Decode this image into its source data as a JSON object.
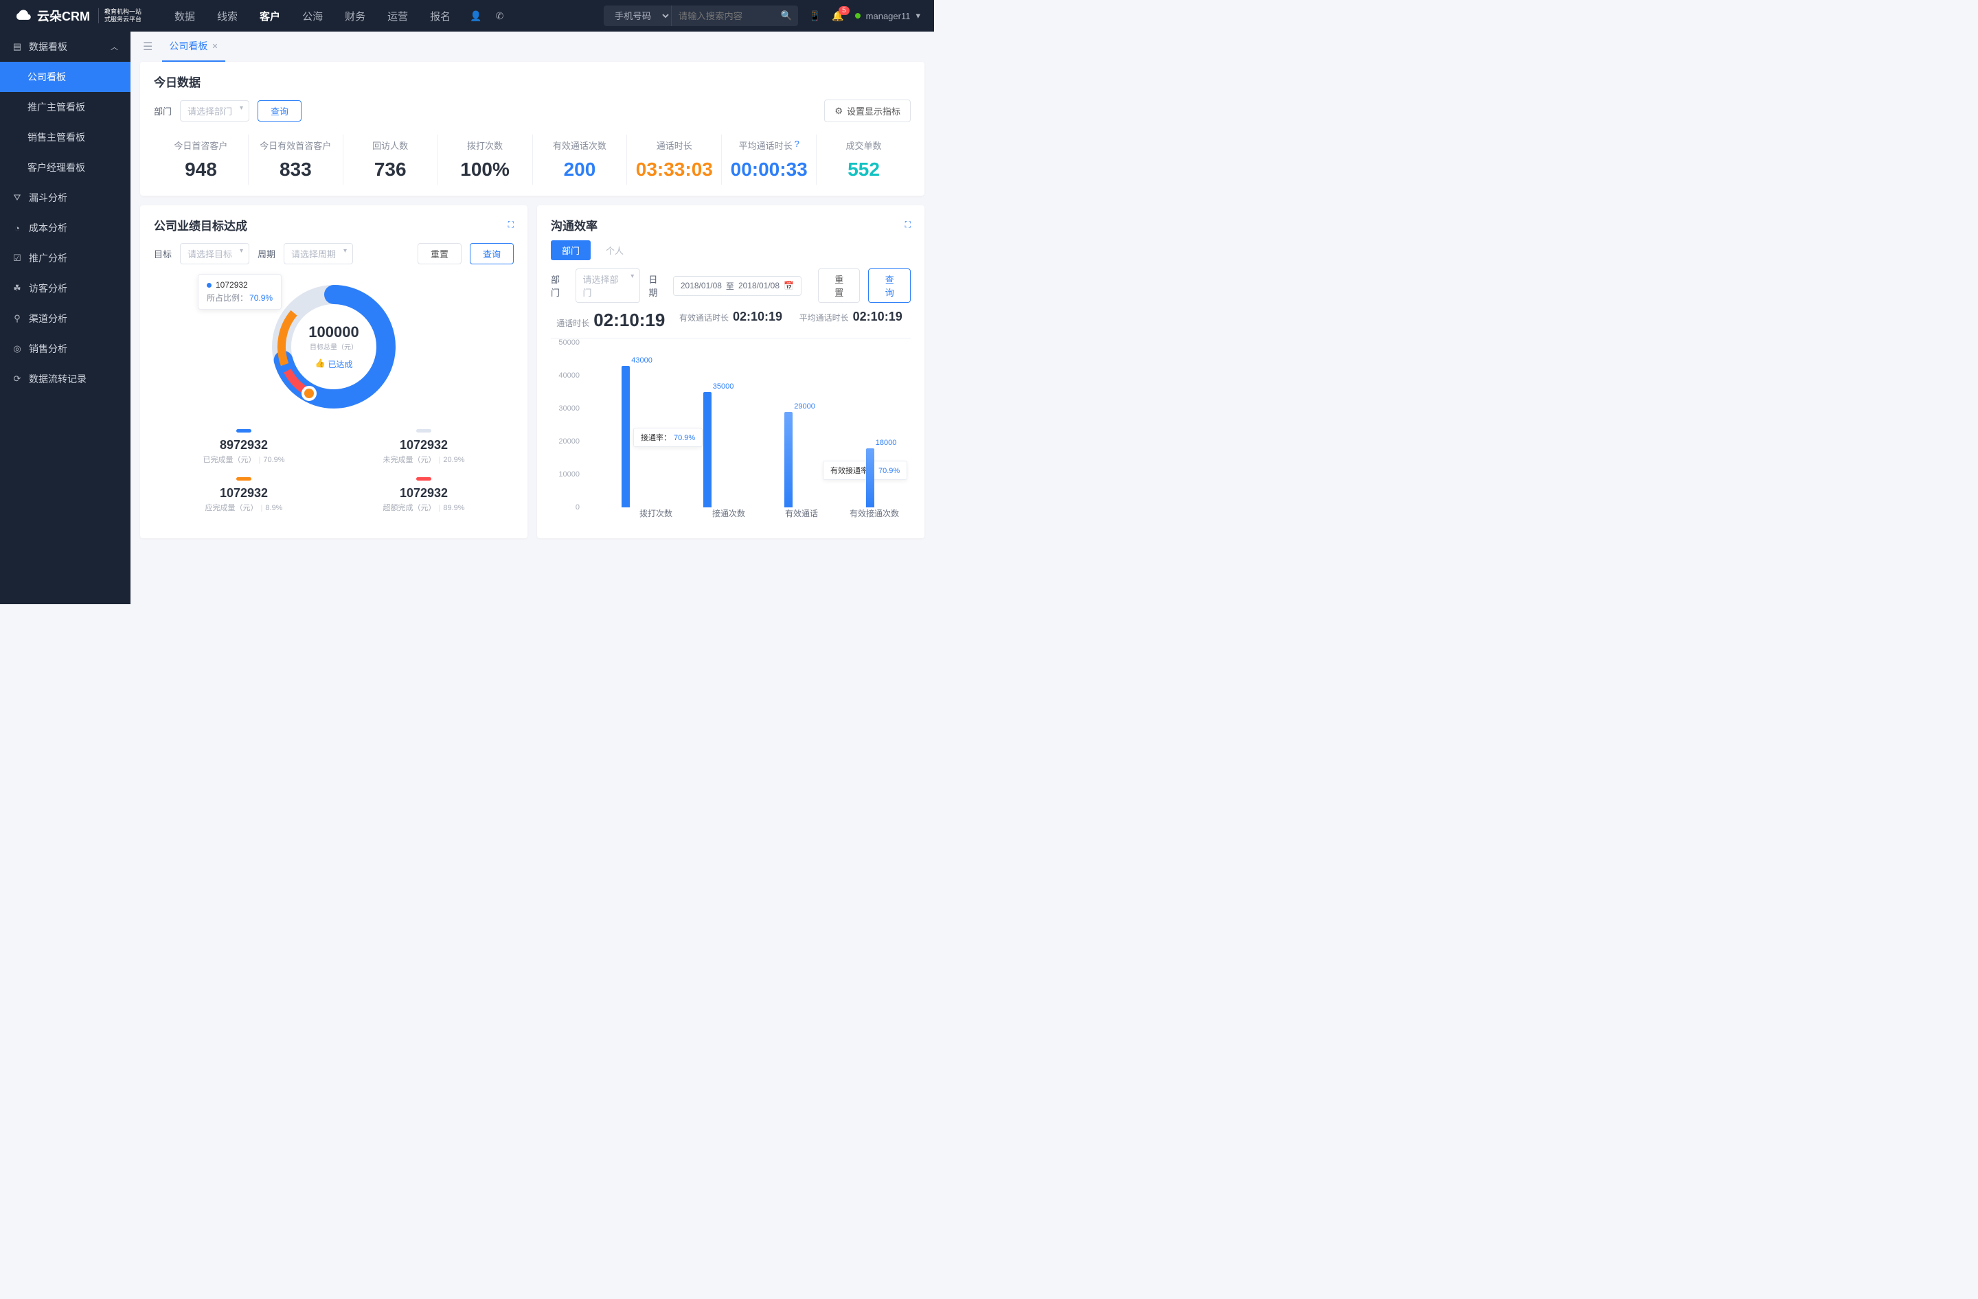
{
  "header": {
    "brand": "云朵CRM",
    "brand_sub1": "教育机构一站",
    "brand_sub2": "式服务云平台",
    "nav": [
      "数据",
      "线索",
      "客户",
      "公海",
      "财务",
      "运营",
      "报名"
    ],
    "nav_active": 2,
    "search_type": "手机号码",
    "search_placeholder": "请输入搜索内容",
    "notif_count": "5",
    "user": "manager11"
  },
  "sidebar": {
    "group": "数据看板",
    "children": [
      "公司看板",
      "推广主管看板",
      "销售主管看板",
      "客户经理看板"
    ],
    "items": [
      {
        "icon": "⛛",
        "label": "漏斗分析"
      },
      {
        "icon": "◔",
        "label": "成本分析"
      },
      {
        "icon": "☑",
        "label": "推广分析"
      },
      {
        "icon": "☘",
        "label": "访客分析"
      },
      {
        "icon": "⚲",
        "label": "渠道分析"
      },
      {
        "icon": "◎",
        "label": "销售分析"
      },
      {
        "icon": "⟳",
        "label": "数据流转记录"
      }
    ]
  },
  "tab": {
    "label": "公司看板"
  },
  "today": {
    "title": "今日数据",
    "dept_lbl": "部门",
    "dept_ph": "请选择部门",
    "query": "查询",
    "settings": "设置显示指标",
    "kpis": [
      {
        "label": "今日首咨客户",
        "value": "948",
        "cls": ""
      },
      {
        "label": "今日有效首咨客户",
        "value": "833",
        "cls": ""
      },
      {
        "label": "回访人数",
        "value": "736",
        "cls": ""
      },
      {
        "label": "拨打次数",
        "value": "100%",
        "cls": ""
      },
      {
        "label": "有效通话次数",
        "value": "200",
        "cls": "blue"
      },
      {
        "label": "通话时长",
        "value": "03:33:03",
        "cls": "orange"
      },
      {
        "label": "平均通话时长",
        "value": "00:00:33",
        "cls": "blue",
        "hint": true
      },
      {
        "label": "成交单数",
        "value": "552",
        "cls": "cyan"
      }
    ]
  },
  "goal": {
    "title": "公司业绩目标达成",
    "target_lbl": "目标",
    "target_ph": "请选择目标",
    "period_lbl": "周期",
    "period_ph": "请选择周期",
    "reset": "重置",
    "query": "查询",
    "center_big": "100000",
    "center_sub": "目标总量（元）",
    "achieved": "已达成",
    "tooltip_val": "1072932",
    "tooltip_ratio_lbl": "所占比例：",
    "tooltip_ratio": "70.9%",
    "legend": [
      {
        "color": "#2d7ff9",
        "val": "8972932",
        "lbl": "已完成量（元）",
        "pct": "70.9%"
      },
      {
        "color": "#dfe5ef",
        "val": "1072932",
        "lbl": "未完成量（元）",
        "pct": "20.9%"
      },
      {
        "color": "#fa8c16",
        "val": "1072932",
        "lbl": "应完成量（元）",
        "pct": "8.9%"
      },
      {
        "color": "#ff4d4f",
        "val": "1072932",
        "lbl": "超额完成（元）",
        "pct": "89.9%"
      }
    ]
  },
  "eff": {
    "title": "沟通效率",
    "seg_dept": "部门",
    "seg_person": "个人",
    "dept_lbl": "部门",
    "dept_ph": "请选择部门",
    "date_lbl": "日期",
    "date_from": "2018/01/08",
    "date_to": "2018/01/08",
    "date_sep": "至",
    "reset": "重置",
    "query": "查询",
    "head": [
      {
        "l": "通话时长",
        "v": "02:10:19",
        "big": true
      },
      {
        "l": "有效通话时长",
        "v": "02:10:19"
      },
      {
        "l": "平均通话时长",
        "v": "02:10:19"
      }
    ],
    "float1": {
      "l": "接通率：",
      "v": "70.9%"
    },
    "float2": {
      "l": "有效接通率：",
      "v": "70.9%"
    }
  },
  "chart_data": [
    {
      "type": "donut",
      "title": "公司业绩目标达成",
      "center_value": 100000,
      "center_label": "目标总量（元）",
      "series": [
        {
          "name": "已完成量（元）",
          "value": 8972932,
          "pct": 70.9,
          "color": "#2d7ff9"
        },
        {
          "name": "未完成量（元）",
          "value": 1072932,
          "pct": 20.9,
          "color": "#dfe5ef"
        },
        {
          "name": "应完成量（元）",
          "value": 1072932,
          "pct": 8.9,
          "color": "#fa8c16"
        },
        {
          "name": "超额完成（元）",
          "value": 1072932,
          "pct": 89.9,
          "color": "#ff4d4f"
        }
      ]
    },
    {
      "type": "bar",
      "title": "沟通效率",
      "categories": [
        "拨打次数",
        "接通次数",
        "有效通话",
        "有效接通次数"
      ],
      "values": [
        43000,
        35000,
        29000,
        18000
      ],
      "ylim": [
        0,
        50000
      ],
      "yticks": [
        0,
        10000,
        20000,
        30000,
        40000,
        50000
      ],
      "annotations": [
        {
          "between": [
            "拨打次数",
            "接通次数"
          ],
          "label": "接通率：",
          "value": "70.9%"
        },
        {
          "between": [
            "有效通话",
            "有效接通次数"
          ],
          "label": "有效接通率：",
          "value": "70.9%"
        }
      ]
    }
  ]
}
